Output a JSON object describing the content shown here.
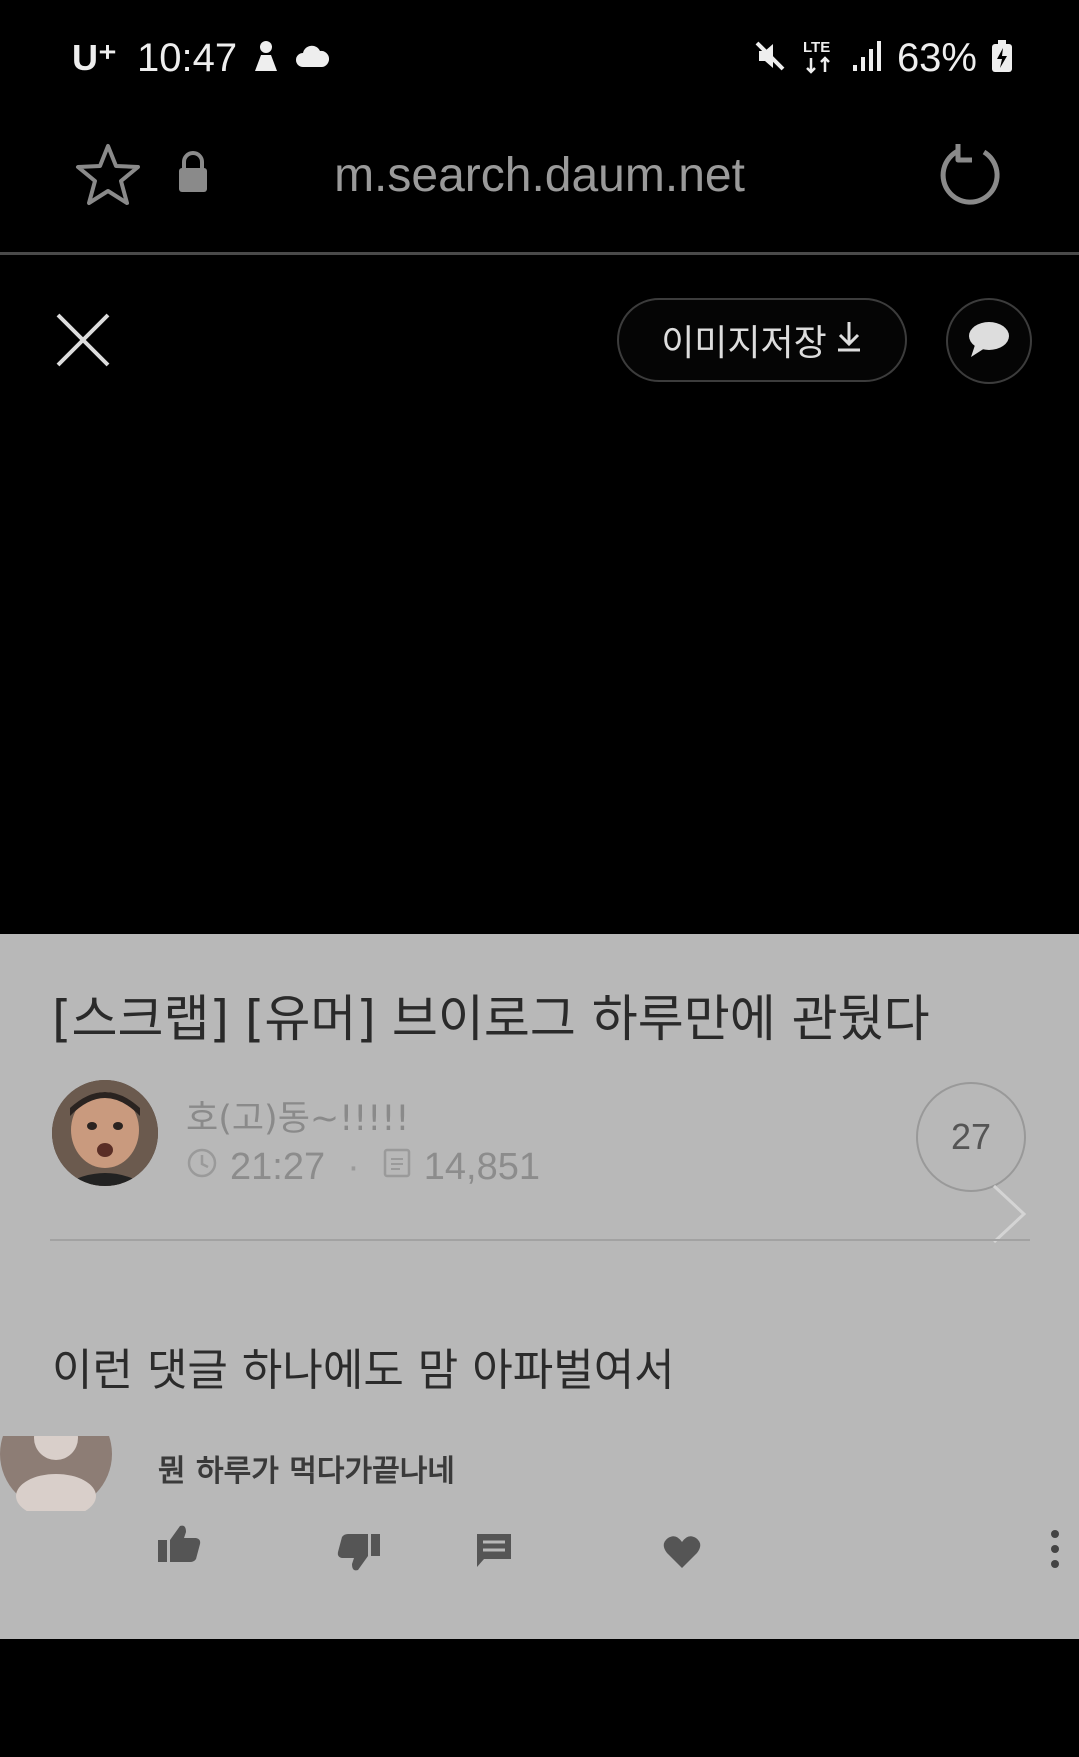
{
  "status_bar": {
    "carrier": "U⁺",
    "time": "10:47",
    "battery": "63%",
    "icons": [
      "person-icon",
      "cloud-icon",
      "mute-icon",
      "lte-icon",
      "signal-icon",
      "battery-charging-icon"
    ]
  },
  "browser": {
    "url": "m.search.daum.net",
    "icons": [
      "star-icon",
      "lock-icon",
      "reload-icon"
    ]
  },
  "viewer": {
    "save_label": "이미지저장",
    "icons": [
      "close-icon",
      "download-icon",
      "comment-icon"
    ]
  },
  "post": {
    "title": "[스크랩] [유머] 브이로그 하루만에 관뒀다",
    "author": "호(고)동~!!!!!",
    "time": "21:27",
    "views": "14,851",
    "comment_count": "27",
    "caption": "이런 댓글 하나에도 맘 아파벌여서",
    "comment_text": "뭔 하루가 먹다가끝나네"
  },
  "colors": {
    "panel_bg": "#b8b8b8",
    "page_bg": "#000000"
  }
}
